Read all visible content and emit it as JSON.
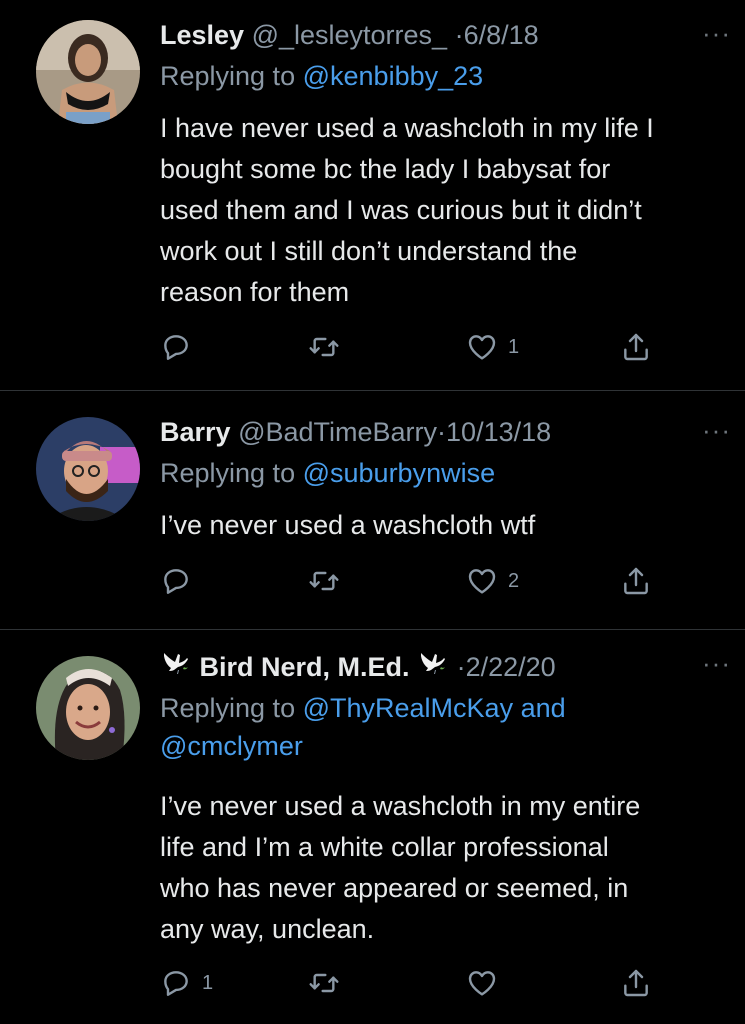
{
  "tweets": [
    {
      "name": "Lesley",
      "handle": "@_lesleytorres_",
      "dot": "·",
      "date": "6/8/18",
      "replying_prefix": "Replying to",
      "mention1": "@kenbibby_23",
      "body_lines": [
        "I have never used a washcloth in my life I",
        "bought some bc the lady I babysat for",
        "used them and I was curious but it didn’t",
        "work out I still don’t understand the",
        "reason for them"
      ],
      "like_count": "1",
      "more": "···"
    },
    {
      "name": "Barry",
      "handle": "@BadTimeBarry",
      "dot": "·",
      "date": "10/13/18",
      "replying_prefix": "Replying to",
      "mention1": "@suburbynwise",
      "body_lines": [
        "I’ve never used a washcloth wtf"
      ],
      "like_count": "2",
      "more": "···"
    },
    {
      "name": "Bird Nerd, M.Ed.",
      "dot": "·",
      "date": "2/22/20",
      "replying_prefix": "Replying to",
      "mention1": "@ThyRealMcKay",
      "and_word": "and",
      "mention2": "@cmclymer",
      "body_lines": [
        "I’ve never used a washcloth in my entire",
        "life and I’m a white collar professional",
        "who has never appeared or seemed, in",
        "any way, unclean."
      ],
      "reply_count": "1",
      "more": "···"
    }
  ],
  "icons": [
    "reply-icon",
    "retweet-icon",
    "like-icon",
    "share-icon",
    "dove-icon",
    "more-icon"
  ],
  "colors": {
    "background": "#000000",
    "text": "#e7e9ea",
    "muted": "#8b98a5",
    "link": "#4a9eeb",
    "divider": "#2f3336"
  }
}
